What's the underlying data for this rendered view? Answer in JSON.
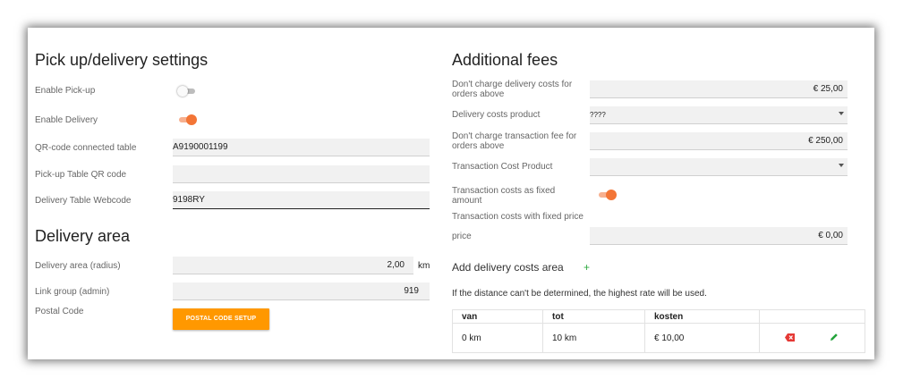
{
  "pickup": {
    "title": "Pick up/delivery settings",
    "enable_pickup_label": "Enable Pick-up",
    "enable_pickup_on": false,
    "enable_delivery_label": "Enable Delivery",
    "enable_delivery_on": true,
    "qr_label": "QR-code connected table",
    "qr_value": "A9190001199",
    "pickup_table_label": "Pick-up Table QR code",
    "pickup_table_value": "",
    "delivery_table_label": "Delivery Table Webcode",
    "delivery_table_value": "9198RY"
  },
  "delivery_area": {
    "title": "Delivery area",
    "radius_label": "Delivery area (radius)",
    "radius_value": "2,00",
    "radius_unit": "km",
    "link_group_label": "Link group (admin)",
    "link_group_value": "919",
    "postal_label": "Postal Code",
    "postal_button": "POSTAL CODE SETUP"
  },
  "fees": {
    "title": "Additional fees",
    "no_delivery_label": "Don't charge delivery costs for orders above",
    "no_delivery_value": "€ 25,00",
    "delivery_product_label": "Delivery costs product",
    "delivery_product_value": "????",
    "no_transaction_label": "Don't charge transaction fee for orders above",
    "no_transaction_value": "€ 250,00",
    "transaction_product_label": "Transaction Cost Product",
    "transaction_product_value": "",
    "fixed_amount_label": "Transaction costs as fixed amount",
    "fixed_amount_on": true,
    "fixed_price_label": "Transaction costs with fixed price",
    "price_label": "price",
    "price_value": "€ 0,00"
  },
  "costs_area": {
    "title": "Add delivery costs area",
    "add_icon": "plus-icon",
    "note": "If the distance can't be determined, the highest rate will be used.",
    "columns": [
      "van",
      "tot",
      "kosten",
      ""
    ],
    "rows": [
      {
        "van": "0 km",
        "tot": "10 km",
        "kosten": "€ 10,00"
      }
    ]
  },
  "colors": {
    "accent": "#ff9800",
    "toggle_on": "#f37536",
    "delete": "#e53935",
    "edit": "#22a33a"
  }
}
